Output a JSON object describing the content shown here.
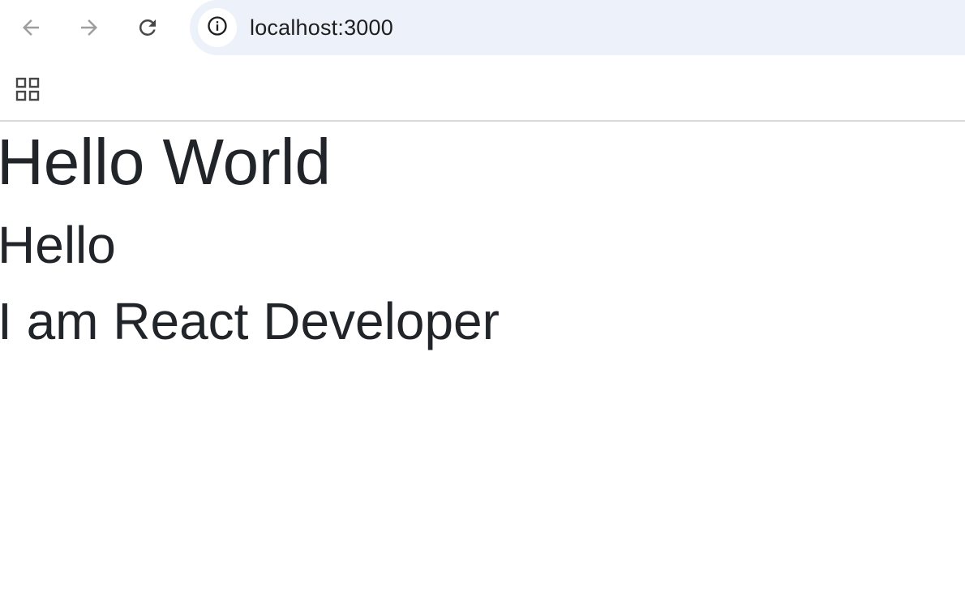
{
  "browser": {
    "url": "localhost:3000",
    "icons": {
      "back": "arrow-left-icon",
      "forward": "arrow-right-icon",
      "reload": "reload-icon",
      "site_info": "info-icon",
      "apps": "apps-grid-icon"
    },
    "colors": {
      "omnibox_bg": "#edf2fa",
      "disabled_icon": "#9e9e9e",
      "active_icon": "#474747"
    }
  },
  "page": {
    "heading": "Hello World",
    "subheading": "Hello",
    "tagline": "I am React Developer",
    "text_color": "#212529"
  }
}
